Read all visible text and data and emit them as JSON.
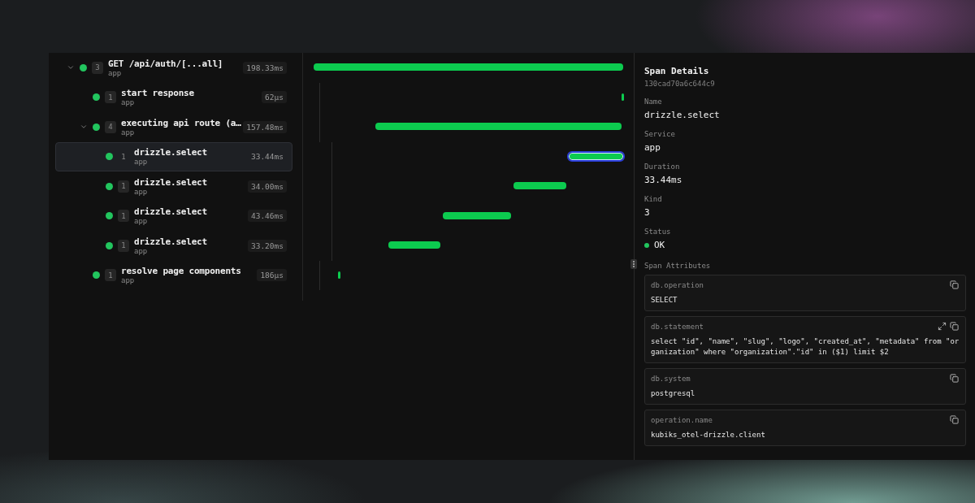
{
  "spans": [
    {
      "name": "GET /api/auth/[...all]",
      "service": "app",
      "count": "3",
      "duration": "198.33ms",
      "expanded": true,
      "selected": false,
      "children": [
        {
          "name": "start response",
          "service": "app",
          "count": "1",
          "duration": "62µs",
          "selected": false
        },
        {
          "name": "executing api route (a…",
          "service": "app",
          "count": "4",
          "duration": "157.48ms",
          "expanded": true,
          "selected": false,
          "children": [
            {
              "name": "drizzle.select",
              "service": "app",
              "count": "1",
              "duration": "33.44ms",
              "selected": true
            },
            {
              "name": "drizzle.select",
              "service": "app",
              "count": "1",
              "duration": "34.00ms",
              "selected": false
            },
            {
              "name": "drizzle.select",
              "service": "app",
              "count": "1",
              "duration": "43.46ms",
              "selected": false
            },
            {
              "name": "drizzle.select",
              "service": "app",
              "count": "1",
              "duration": "33.20ms",
              "selected": false
            }
          ]
        },
        {
          "name": "resolve page components",
          "service": "app",
          "count": "1",
          "duration": "186µs",
          "selected": false
        }
      ]
    }
  ],
  "details": {
    "title": "Span Details",
    "span_id": "130cad70a6c644c9",
    "fields": [
      {
        "label": "Name",
        "value": "drizzle.select"
      },
      {
        "label": "Service",
        "value": "app"
      },
      {
        "label": "Duration",
        "value": "33.44ms"
      },
      {
        "label": "Kind",
        "value": "3"
      },
      {
        "label": "Status",
        "value": "OK",
        "color": "#22c55e"
      }
    ],
    "attributes_title": "Span Attributes",
    "attributes": [
      {
        "key": "db.operation",
        "value": "SELECT",
        "expandable": false
      },
      {
        "key": "db.statement",
        "value": "select \"id\", \"name\", \"slug\", \"logo\", \"created_at\", \"metadata\" from \"organization\" where \"organization\".\"id\" in ($1) limit $2",
        "expandable": true
      },
      {
        "key": "db.system",
        "value": "postgresql",
        "expandable": false
      },
      {
        "key": "operation.name",
        "value": "kubiks_otel-drizzle.client",
        "expandable": false
      }
    ]
  }
}
